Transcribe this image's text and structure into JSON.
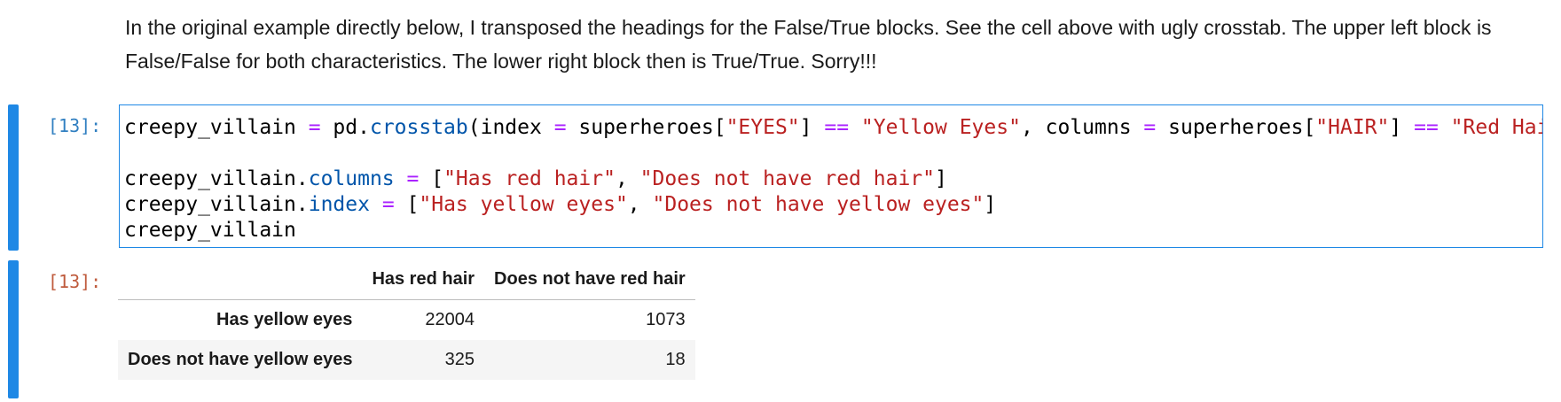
{
  "markdown": {
    "text": "In the original example directly below, I transposed the headings for the False/True blocks. See the cell above with ugly crosstab. The upper left block is False/False for both characteristics. The lower right block then is True/True. Sorry!!!"
  },
  "code_cell": {
    "prompt": "[13]:",
    "lines": {
      "line1": {
        "t1": "creepy_villain ",
        "op1": "=",
        "t2": " pd.",
        "fn": "crosstab",
        "t3": "(index ",
        "op2": "=",
        "t4": " superheroes[",
        "s1": "\"EYES\"",
        "t5": "] ",
        "op3": "==",
        "t6": " ",
        "s2": "\"Yellow Eyes\"",
        "t7": ", columns ",
        "op4": "=",
        "t8": " superheroes[",
        "s3": "\"HAIR\"",
        "t9": "] ",
        "op5": "==",
        "t10": " ",
        "s4": "\"Red Hair\""
      },
      "line2": {
        "t1": "creepy_villain.",
        "a1": "columns",
        "t2": " ",
        "op1": "=",
        "t3": " [",
        "s1": "\"Has red hair\"",
        "t4": ", ",
        "s2": "\"Does not have red hair\"",
        "t5": "]"
      },
      "line3": {
        "t1": "creepy_villain.",
        "a1": "index",
        "t2": " ",
        "op1": "=",
        "t3": " [",
        "s1": "\"Has yellow eyes\"",
        "t4": ", ",
        "s2": "\"Does not have yellow eyes\"",
        "t5": "]"
      },
      "line4": {
        "t1": "creepy_villain"
      }
    }
  },
  "output_cell": {
    "prompt": "[13]:",
    "table": {
      "columns": [
        "Has red hair",
        "Does not have red hair"
      ],
      "rows": [
        {
          "index": "Has yellow eyes",
          "values": [
            "22004",
            "1073"
          ]
        },
        {
          "index": "Does not have yellow eyes",
          "values": [
            "325",
            "18"
          ]
        }
      ]
    }
  },
  "colors": {
    "accent": "#1e88e5",
    "in_prompt": "#307fc1",
    "out_prompt": "#bf5b3d",
    "operator": "#aa22ff",
    "string": "#ba2121",
    "attribute": "#0055aa"
  }
}
